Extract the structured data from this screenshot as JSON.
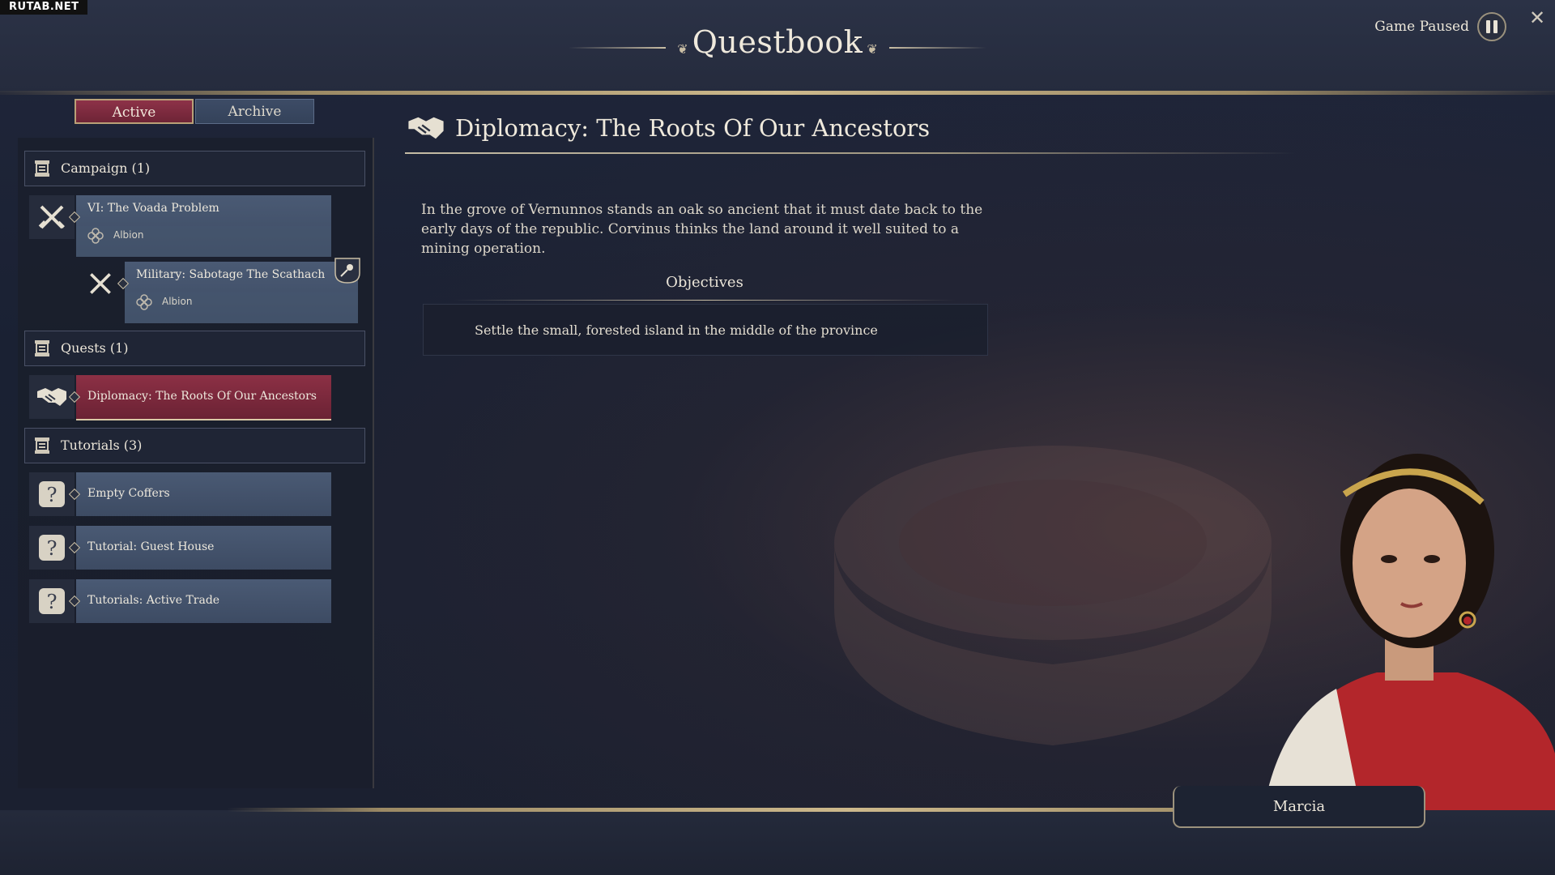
{
  "watermark": "RUTAB.NET",
  "header": {
    "title": "Questbook",
    "pause_label": "Game Paused",
    "close_label": "✕"
  },
  "tabs": {
    "active": "Active",
    "archive": "Archive"
  },
  "sections": {
    "campaign": "Campaign (1)",
    "quests": "Quests (1)",
    "tutorials": "Tutorials (3)"
  },
  "campaign_items": [
    {
      "name": "VI: The Voada Problem",
      "location": "Albion"
    },
    {
      "name": "Military: Sabotage The Scathach",
      "location": "Albion"
    }
  ],
  "quest_items": [
    {
      "name": "Diplomacy: The Roots Of Our Ancestors"
    }
  ],
  "tutorial_items": [
    {
      "name": "Empty Coffers"
    },
    {
      "name": "Tutorial: Guest House"
    },
    {
      "name": "Tutorials: Active Trade"
    }
  ],
  "detail": {
    "title": "Diplomacy: The Roots Of Our Ancestors",
    "description": "In the grove of Vernunnos stands an oak so ancient that it must date back to the early days of the republic. Corvinus thinks the land around it well suited to a mining operation.",
    "objectives_title": "Objectives",
    "objectives": [
      "Settle the small, forested island in the middle of the province"
    ]
  },
  "character": {
    "name": "Marcia"
  },
  "colors": {
    "accent": "#8d3248",
    "gold": "#c9bea5",
    "card": "#4a5a74"
  }
}
